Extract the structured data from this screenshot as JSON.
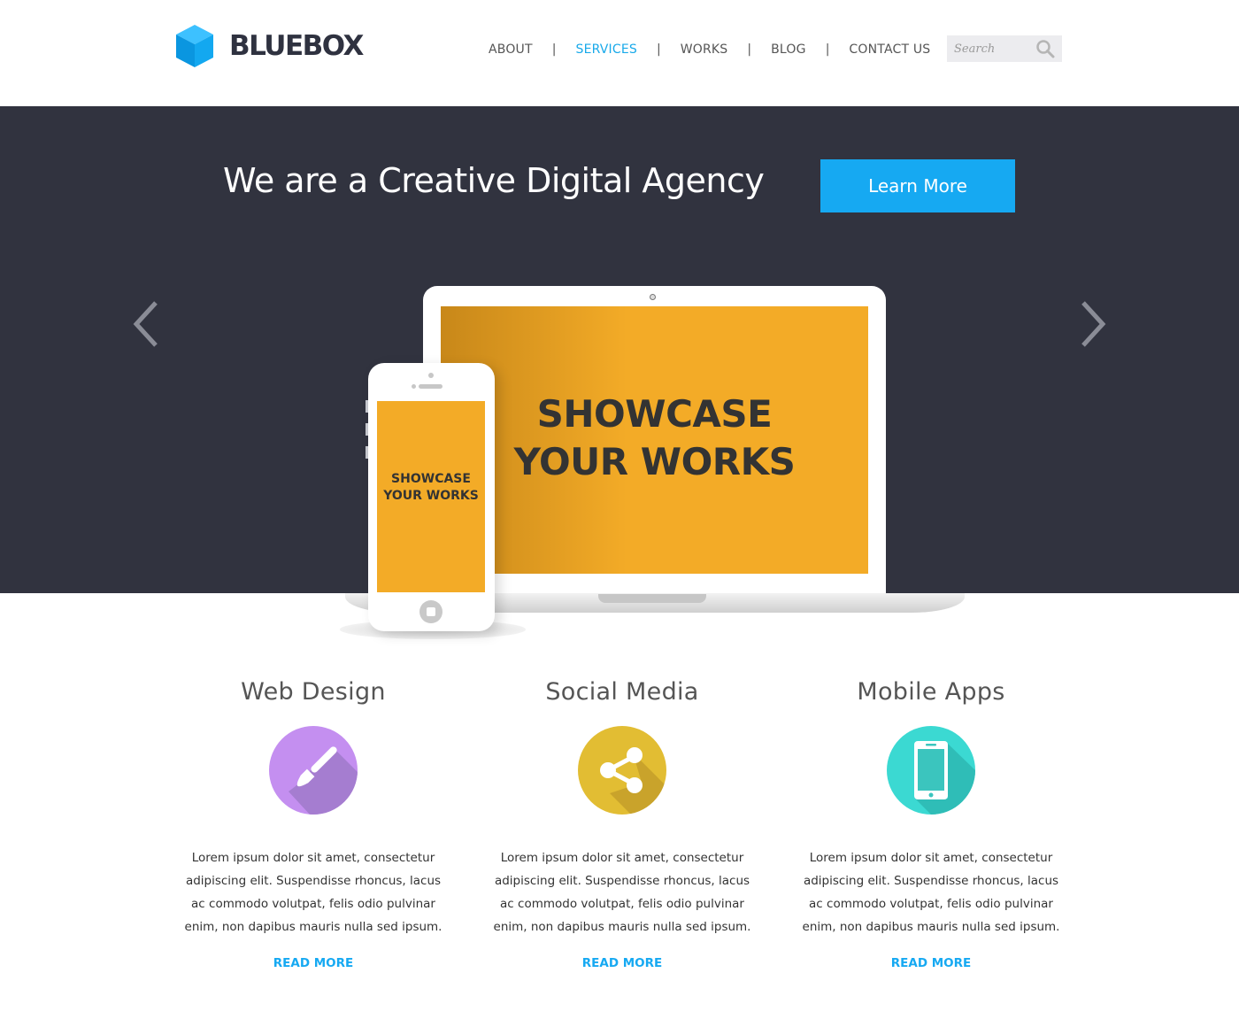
{
  "brand": {
    "name": "BLUEBOX",
    "accent": "#16a9f2",
    "dark": "#31333f",
    "icon": "cube-icon"
  },
  "nav": {
    "items": [
      {
        "label": "ABOUT",
        "active": false
      },
      {
        "label": "SERVICES",
        "active": true
      },
      {
        "label": "WORKS",
        "active": false
      },
      {
        "label": "BLOG",
        "active": false
      },
      {
        "label": "CONTACT US",
        "active": false
      }
    ],
    "separator": "|"
  },
  "search": {
    "placeholder": "Search",
    "icon": "search-icon"
  },
  "hero": {
    "title": "We are a Creative Digital Agency",
    "cta_label": "Learn More",
    "prev_icon": "chevron-left-icon",
    "next_icon": "chevron-right-icon",
    "laptop_text_line1": "SHOWCASE",
    "laptop_text_line2": "YOUR WORKS",
    "phone_text_line1": "SHOWCASE",
    "phone_text_line2": "YOUR WORKS",
    "screen_color": "#f3ab27"
  },
  "services": [
    {
      "title": "Web Design",
      "icon": "paintbrush-icon",
      "color": "#c48ff0",
      "text": "Lorem ipsum dolor sit amet, consectetur adipiscing elit. Suspendisse rhoncus, lacus ac commodo volutpat, felis odio pulvinar enim, non dapibus mauris nulla sed ipsum.",
      "link": "READ MORE"
    },
    {
      "title": "Social Media",
      "icon": "share-icon",
      "color": "#e2bd33",
      "text": "Lorem ipsum dolor sit amet, consectetur adipiscing elit. Suspendisse rhoncus, lacus ac commodo volutpat, felis odio pulvinar enim, non dapibus mauris nulla sed ipsum.",
      "link": "READ MORE"
    },
    {
      "title": "Mobile Apps",
      "icon": "smartphone-icon",
      "color": "#3bd9d2",
      "text": "Lorem ipsum dolor sit amet, consectetur adipiscing elit. Suspendisse rhoncus, lacus ac commodo volutpat, felis odio pulvinar enim, non dapibus mauris nulla sed ipsum.",
      "link": "READ MORE"
    }
  ]
}
